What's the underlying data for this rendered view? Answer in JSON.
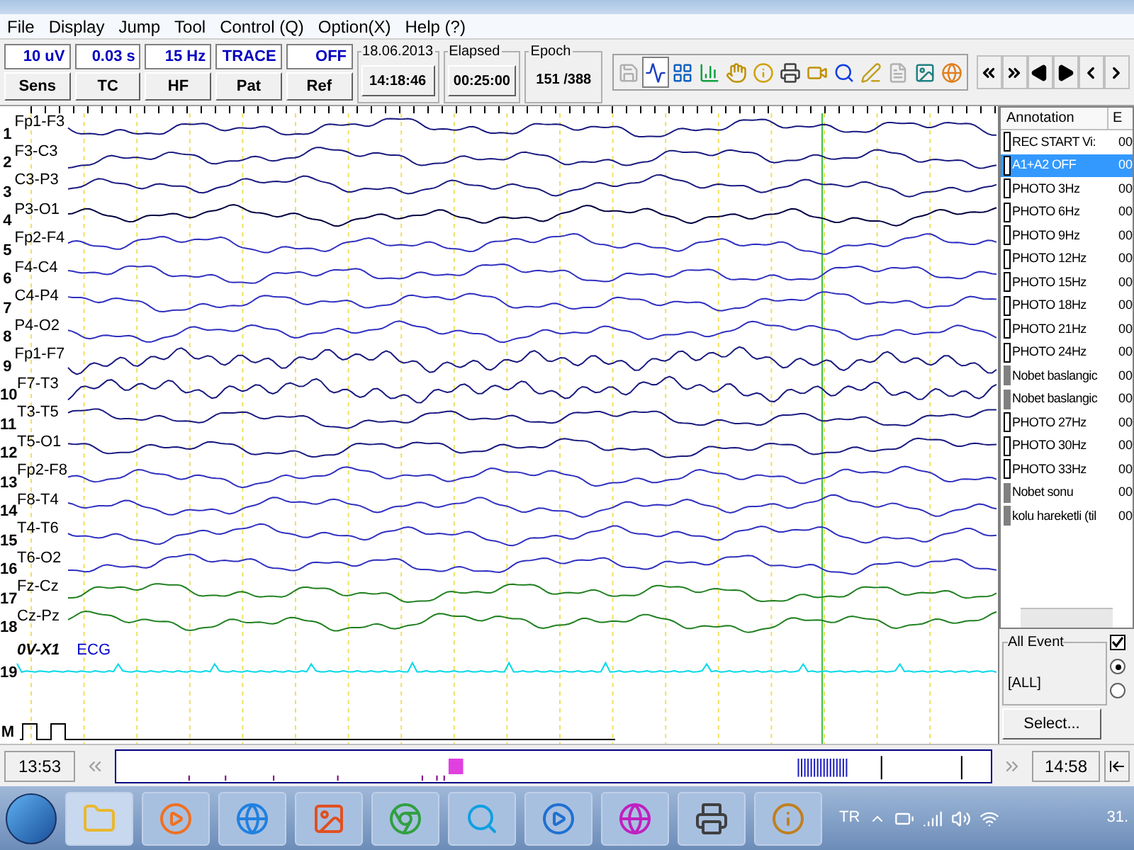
{
  "menu": [
    "File",
    "Display",
    "Jump",
    "Tool",
    "Control (Q)",
    "Option(X)",
    "Help (?)"
  ],
  "params": [
    {
      "value": "10 uV",
      "button": "Sens"
    },
    {
      "value": "0.03 s",
      "button": "TC"
    },
    {
      "value": "15 Hz",
      "button": "HF"
    },
    {
      "value": "TRACE",
      "button": "Pat"
    },
    {
      "value": "OFF",
      "button": "Ref"
    }
  ],
  "info_groups": [
    {
      "legend": "18.06.2013",
      "value": "14:18:46",
      "kind": "button"
    },
    {
      "legend": "Elapsed",
      "value": "00:25:00",
      "kind": "button"
    },
    {
      "legend": "Epoch",
      "value": "151 /388",
      "kind": "plain"
    }
  ],
  "tools": [
    {
      "selected": false,
      "disabled": true
    },
    {
      "selected": true,
      "disabled": false
    },
    {
      "selected": false,
      "disabled": false
    },
    {
      "selected": false,
      "disabled": false
    },
    {
      "selected": false,
      "disabled": false
    },
    {
      "selected": false,
      "disabled": false
    },
    {
      "selected": false,
      "disabled": false
    },
    {
      "selected": false,
      "disabled": false
    },
    {
      "selected": false,
      "disabled": false
    },
    {
      "selected": false,
      "disabled": false
    },
    {
      "selected": false,
      "disabled": true
    },
    {
      "selected": false,
      "disabled": false
    },
    {
      "selected": false,
      "disabled": false
    }
  ],
  "channels": [
    {
      "number": "1",
      "label": "Fp1-F3",
      "color": "#1a1a80"
    },
    {
      "number": "2",
      "label": "F3-C3",
      "color": "#1a1a80"
    },
    {
      "number": "3",
      "label": "C3-P3",
      "color": "#1a1a80"
    },
    {
      "number": "4",
      "label": "P3-O1",
      "color": "#000040"
    },
    {
      "number": "5",
      "label": "Fp2-F4",
      "color": "#3030c0"
    },
    {
      "number": "6",
      "label": "F4-C4",
      "color": "#3030c0"
    },
    {
      "number": "7",
      "label": "C4-P4",
      "color": "#3030c0"
    },
    {
      "number": "8",
      "label": "P4-O2",
      "color": "#3030c0"
    },
    {
      "number": "9",
      "label": "Fp1-F7",
      "color": "#1a1a80"
    },
    {
      "number": "10",
      "label": "F7-T3",
      "color": "#1a1a80"
    },
    {
      "number": "11",
      "label": "T3-T5",
      "color": "#1a1a80"
    },
    {
      "number": "12",
      "label": "T5-O1",
      "color": "#1a1a80"
    },
    {
      "number": "13",
      "label": "Fp2-F8",
      "color": "#3030c0"
    },
    {
      "number": "14",
      "label": "F8-T4",
      "color": "#3030c0"
    },
    {
      "number": "15",
      "label": "T4-T6",
      "color": "#3030c0"
    },
    {
      "number": "16",
      "label": "T6-O2",
      "color": "#3030c0"
    },
    {
      "number": "17",
      "label": "Fz-Cz",
      "color": "#208020"
    },
    {
      "number": "18",
      "label": "Cz-Pz",
      "color": "#208020"
    }
  ],
  "ecg": {
    "number": "19",
    "label": "0V-X1",
    "name": "ECG",
    "color": "#00d8e8"
  },
  "marker_row": {
    "number": "M"
  },
  "annotations": {
    "columns": [
      "Annotation",
      "E"
    ],
    "items": [
      {
        "label": "REC START Vi:",
        "column_2": "00",
        "kind": "open",
        "selected": false
      },
      {
        "label": "A1+A2 OFF",
        "column_2": "00",
        "kind": "open",
        "selected": true
      },
      {
        "label": "PHOTO 3Hz",
        "column_2": "00",
        "kind": "open",
        "selected": false
      },
      {
        "label": "PHOTO 6Hz",
        "column_2": "00",
        "kind": "open",
        "selected": false
      },
      {
        "label": "PHOTO 9Hz",
        "column_2": "00",
        "kind": "open",
        "selected": false
      },
      {
        "label": "PHOTO 12Hz",
        "column_2": "00",
        "kind": "open",
        "selected": false
      },
      {
        "label": "PHOTO 15Hz",
        "column_2": "00",
        "kind": "open",
        "selected": false
      },
      {
        "label": "PHOTO 18Hz",
        "column_2": "00",
        "kind": "open",
        "selected": false
      },
      {
        "label": "PHOTO 21Hz",
        "column_2": "00",
        "kind": "open",
        "selected": false
      },
      {
        "label": "PHOTO 24Hz",
        "column_2": "00",
        "kind": "open",
        "selected": false
      },
      {
        "label": "Nobet baslangic",
        "column_2": "00",
        "kind": "filled",
        "selected": false
      },
      {
        "label": "Nobet baslangic",
        "column_2": "00",
        "kind": "filled",
        "selected": false
      },
      {
        "label": "PHOTO 27Hz",
        "column_2": "00",
        "kind": "open",
        "selected": false
      },
      {
        "label": "PHOTO 30Hz",
        "column_2": "00",
        "kind": "open",
        "selected": false
      },
      {
        "label": "PHOTO 33Hz",
        "column_2": "00",
        "kind": "open",
        "selected": false
      },
      {
        "label": "Nobet sonu",
        "column_2": "00",
        "kind": "filled",
        "selected": false
      },
      {
        "label": "kolu hareketli (til",
        "column_2": "00",
        "kind": "filled",
        "selected": false
      }
    ]
  },
  "event_group": {
    "legend": "All Event",
    "value": "[ALL]",
    "checked": true,
    "radios": [
      {
        "selected": true
      },
      {
        "selected": false
      }
    ],
    "button": "Select..."
  },
  "timeline": {
    "start": "13:53",
    "end": "14:58"
  },
  "taskbar": {
    "language": "TR",
    "clock": "31."
  }
}
